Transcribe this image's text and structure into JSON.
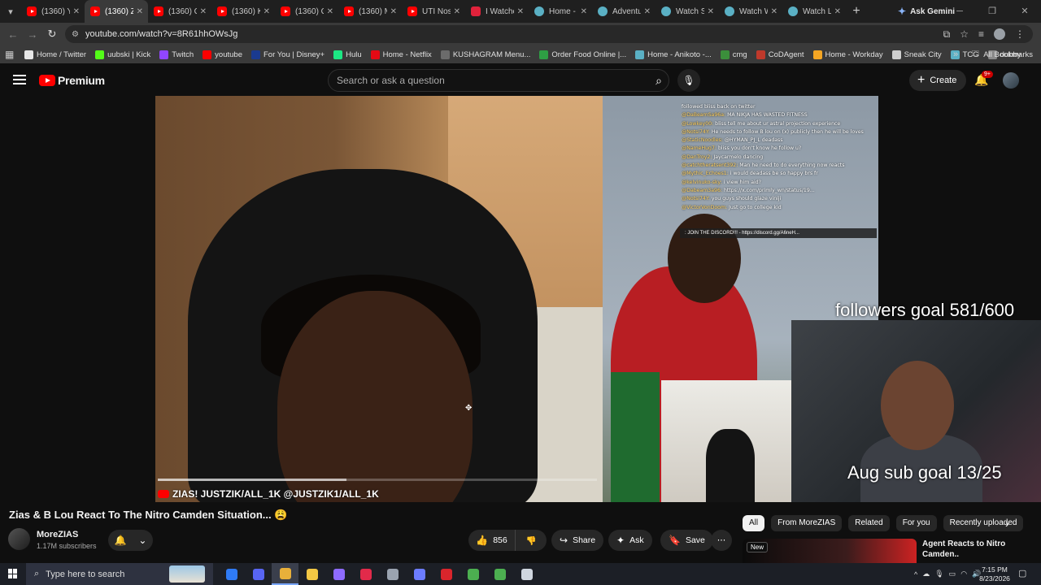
{
  "browser": {
    "tabs": [
      {
        "label": "(1360) Yo",
        "fav": "yt"
      },
      {
        "label": "(1360) Zi",
        "fav": "yt",
        "active": true
      },
      {
        "label": "(1360) C",
        "fav": "yt"
      },
      {
        "label": "(1360) Ki",
        "fav": "yt"
      },
      {
        "label": "(1360) C",
        "fav": "yt"
      },
      {
        "label": "(1360) M",
        "fav": "yt"
      },
      {
        "label": "UTI Nos",
        "fav": "yt"
      },
      {
        "label": "I Watche",
        "fav": "red"
      },
      {
        "label": "Home -",
        "fav": "globe"
      },
      {
        "label": "Adventu",
        "fav": "globe"
      },
      {
        "label": "Watch S",
        "fav": "globe"
      },
      {
        "label": "Watch W",
        "fav": "globe"
      },
      {
        "label": "Watch L",
        "fav": "globe"
      }
    ],
    "gemini_label": "Ask Gemini",
    "url": "youtube.com/watch?v=8R61hhOWsJg",
    "bookmarks": [
      {
        "label": "Home / Twitter",
        "color": "#e7e7e7"
      },
      {
        "label": "uubski | Kick",
        "color": "#53fc18"
      },
      {
        "label": "Twitch",
        "color": "#9146ff"
      },
      {
        "label": "youtube",
        "color": "#ff0000"
      },
      {
        "label": "For You | Disney+",
        "color": "#1a3a8f"
      },
      {
        "label": "Hulu",
        "color": "#1ce783"
      },
      {
        "label": "Home - Netflix",
        "color": "#e50914"
      },
      {
        "label": "KUSHAGRAM Menu...",
        "color": "#6b6b6b"
      },
      {
        "label": "Order Food Online |...",
        "color": "#2e9e44"
      },
      {
        "label": "Home - Anikoto -...",
        "color": "#5ab0c4"
      },
      {
        "label": "cmg",
        "color": "#3b8f3b"
      },
      {
        "label": "CoDAgent",
        "color": "#c0392b"
      },
      {
        "label": "Home - Workday",
        "color": "#f5a623"
      },
      {
        "label": "Sneak City",
        "color": "#cfcfcf"
      },
      {
        "label": "TCG",
        "color": "#5ab0c4"
      },
      {
        "label": "dubby",
        "color": "#8a8a8a"
      }
    ],
    "all_bookmarks_label": "All Bookmarks"
  },
  "youtube": {
    "brand": "Premium",
    "search_placeholder": "Search or ask a question",
    "create_label": "Create",
    "notif_count": "9+",
    "video": {
      "chat_lines": [
        {
          "name": "",
          "text": "followed bliss back on twitter"
        },
        {
          "name": "@DaBeamSa96a:",
          "text": "MA NIKJA HAS WASTED FITNESS"
        },
        {
          "name": "@Lowkey00:",
          "text": "bliss tell me about ur astral projection experience"
        },
        {
          "name": "@Notsi74Y:",
          "text": "He needs to follow B lou on (x) publicly then he will be loves"
        },
        {
          "name": "@StaticNoodles:",
          "text": "@HYMAN_PJ_L deadass"
        },
        {
          "name": "@NameHug7:",
          "text": "bliss you don't know he follow u?"
        },
        {
          "name": "@DanTroy2:",
          "text": "Jaycarmelo dancing"
        },
        {
          "name": "@catchtheratsent392:",
          "text": "Man he need to do everything now reacts"
        },
        {
          "name": "@Mythic_Echoes1:",
          "text": "i would deadass be so happy brs fr"
        },
        {
          "name": "@kelvinuko-sky:",
          "text": "i view him aid?"
        },
        {
          "name": "@Dabeam3a96:",
          "text": "https://x.com/primly_wn/status/19..."
        },
        {
          "name": "@Notsi74Y:",
          "text": "you guys should glaze viniji"
        },
        {
          "name": "@VictorVonDoom:",
          "text": "Just go to college kid"
        }
      ],
      "chat_banner": ": JOIN THE DISCORD!!! - https://discord.gg/A6neH...",
      "followers_goal": "followers goal 581/600",
      "sub_goal": "Aug sub goal 13/25",
      "watermark": "ZIAS! JUSTZIK/ALL_1K @JUSTZIK1/ALL_1K",
      "progress": 0.43
    },
    "title": "Zias & B Lou React To The Nitro Camden Situation... 😩",
    "channel": {
      "name": "MoreZIAS",
      "subs": "1.17M subscribers"
    },
    "actions": {
      "likes": "856",
      "share": "Share",
      "ask": "Ask",
      "save": "Save"
    },
    "chips": [
      "All",
      "From MoreZIAS",
      "Related",
      "For you",
      "Recently uploaded"
    ],
    "recommended": {
      "badge": "New",
      "title": "Agent Reacts to Nitro Camden.."
    }
  },
  "taskbar": {
    "search_placeholder": "Type here to search",
    "time": "7:15 PM",
    "date": "8/23/2026",
    "apps": [
      {
        "name": "copilot",
        "color": "#2f7bf6"
      },
      {
        "name": "discord-ish",
        "color": "#5865f2"
      },
      {
        "name": "chrome",
        "color": "#e8b03a"
      },
      {
        "name": "files",
        "color": "#f2c744"
      },
      {
        "name": "game",
        "color": "#8e6bff"
      },
      {
        "name": "media",
        "color": "#e22a4a"
      },
      {
        "name": "steam",
        "color": "#9aa3b0"
      },
      {
        "name": "app",
        "color": "#6c7cff"
      },
      {
        "name": "pdf",
        "color": "#d9252c"
      },
      {
        "name": "chrome2",
        "color": "#4caf50"
      },
      {
        "name": "chrome3",
        "color": "#4caf50"
      },
      {
        "name": "clock",
        "color": "#cfd6df"
      }
    ]
  }
}
